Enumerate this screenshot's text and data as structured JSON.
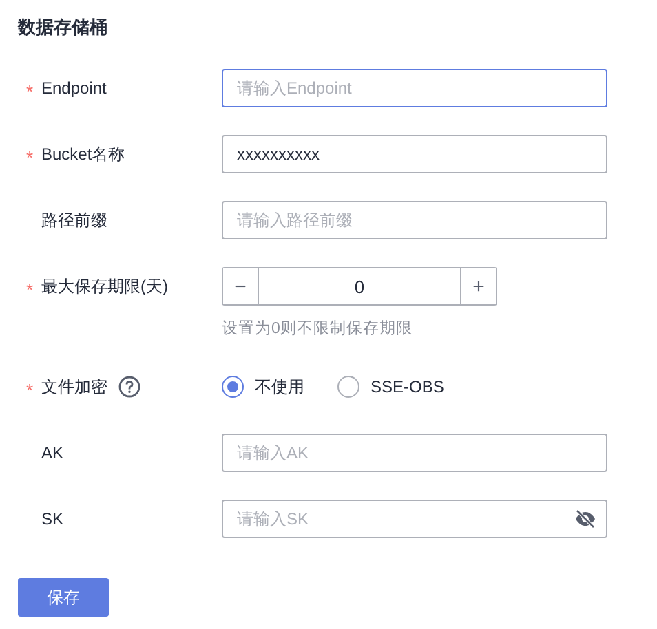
{
  "title": "数据存储桶",
  "fields": [
    {
      "kind": "text",
      "label": "Endpoint",
      "required": true,
      "placeholder": "请输入Endpoint",
      "focused": true
    },
    {
      "kind": "text",
      "label": "Bucket名称",
      "required": true,
      "value": "xxxxxxxxxx",
      "focused": false
    },
    {
      "kind": "text",
      "label": "路径前缀",
      "required": false,
      "placeholder": "请输入路径前缀",
      "focused": false
    },
    {
      "kind": "stepper",
      "label": "最大保存期限(天)",
      "required": true,
      "minus": "−",
      "plus": "+",
      "value": "0",
      "hint": "设置为0则不限制保存期限"
    },
    {
      "kind": "radio",
      "label": "文件加密",
      "required": true,
      "help": true,
      "options": [
        {
          "label": "不使用",
          "selected": true
        },
        {
          "label": "SSE-OBS",
          "selected": false
        }
      ]
    },
    {
      "kind": "text",
      "label": "AK",
      "required": false,
      "placeholder": "请输入AK",
      "focused": false
    },
    {
      "kind": "password",
      "label": "SK",
      "required": false,
      "placeholder": "请输入SK",
      "focused": false
    }
  ],
  "required_mark": "*",
  "save_button": "保存"
}
